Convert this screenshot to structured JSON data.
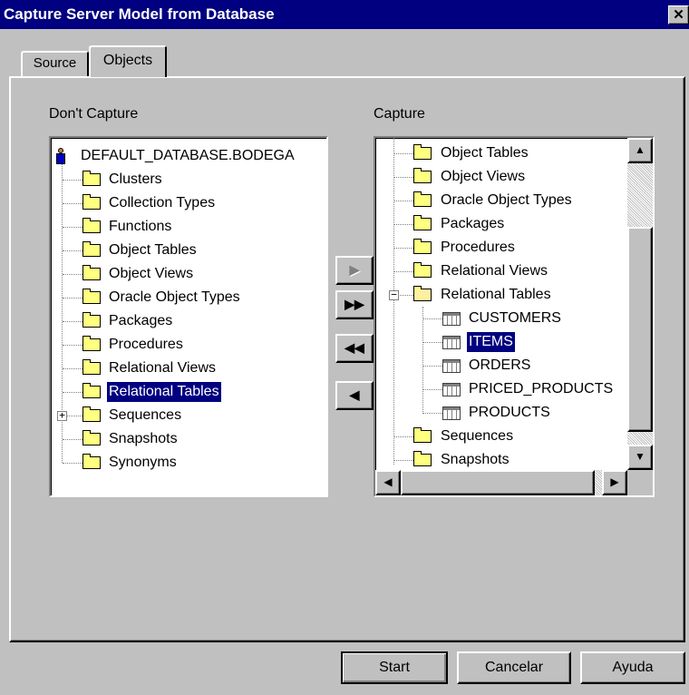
{
  "window": {
    "title": "Capture Server Model from Database",
    "close_label": "✕"
  },
  "tabs": [
    {
      "label": "Source",
      "active": false
    },
    {
      "label": "Objects",
      "active": true
    }
  ],
  "left": {
    "heading": "Don't Capture",
    "root": "DEFAULT_DATABASE.BODEGA",
    "items": [
      "Clusters",
      "Collection Types",
      "Functions",
      "Object Tables",
      "Object Views",
      "Oracle Object Types",
      "Packages",
      "Procedures",
      "Relational Views",
      "Relational Tables",
      "Sequences",
      "Snapshots",
      "Synonyms"
    ],
    "selected": "Relational Tables",
    "expandable": "Sequences"
  },
  "right": {
    "heading": "Capture",
    "items": [
      "Object Tables",
      "Object Views",
      "Oracle Object Types",
      "Packages",
      "Procedures",
      "Relational Views",
      "Relational Tables",
      "CUSTOMERS",
      "ITEMS",
      "ORDERS",
      "PRICED_PRODUCTS",
      "PRODUCTS",
      "Sequences",
      "Snapshots"
    ],
    "selected": "ITEMS"
  },
  "transfer_buttons": [
    "▶",
    "▶▶",
    "◀◀",
    "◀"
  ],
  "scroll_arrows": {
    "up": "▲",
    "down": "▼",
    "left": "◀",
    "right": "▶"
  },
  "expander_symbols": {
    "collapsed": "+",
    "expanded": "−"
  },
  "buttons": {
    "start": "Start",
    "cancel": "Cancelar",
    "help": "Ayuda"
  }
}
